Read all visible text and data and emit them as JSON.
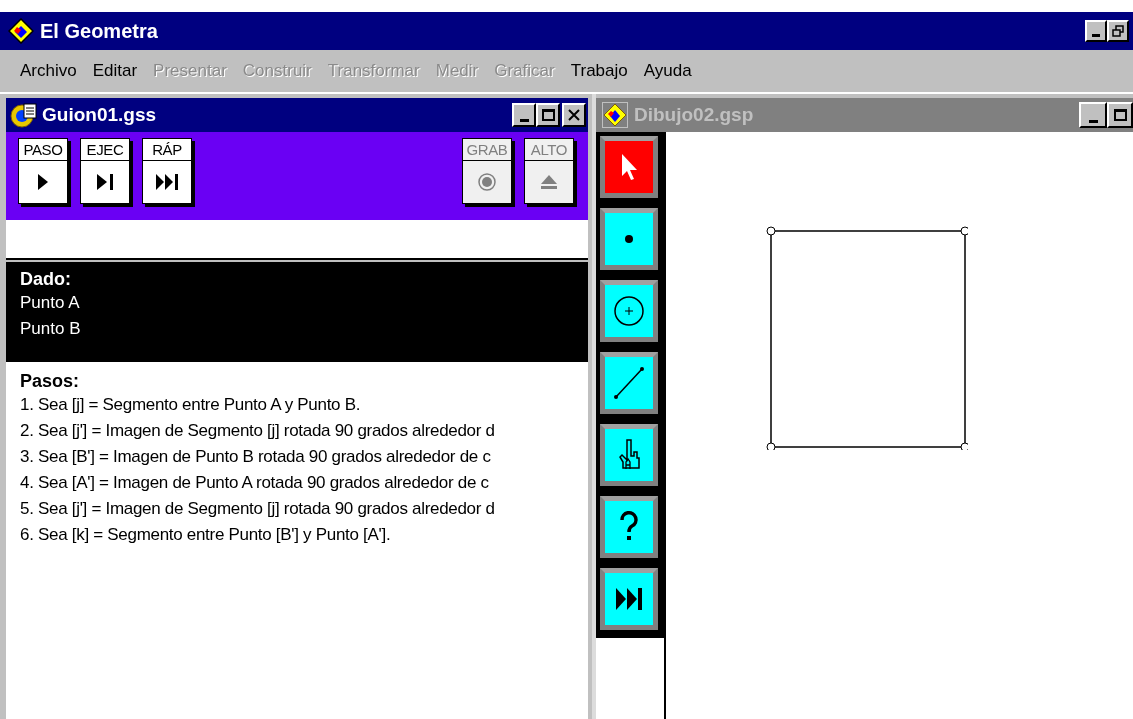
{
  "app": {
    "title": "El Geometra"
  },
  "menu": [
    {
      "label": "Archivo",
      "disabled": false
    },
    {
      "label": "Editar",
      "disabled": false
    },
    {
      "label": "Presentar",
      "disabled": true
    },
    {
      "label": "Construir",
      "disabled": true
    },
    {
      "label": "Transformar",
      "disabled": true
    },
    {
      "label": "Medir",
      "disabled": true
    },
    {
      "label": "Graficar",
      "disabled": true
    },
    {
      "label": "Trabajo",
      "disabled": false
    },
    {
      "label": "Ayuda",
      "disabled": false
    }
  ],
  "script_window": {
    "title": "Guion01.gss",
    "active": true,
    "controls": [
      {
        "label": "PASO",
        "kind": "step",
        "disabled": false
      },
      {
        "label": "EJEC",
        "kind": "run",
        "disabled": false
      },
      {
        "label": "RÁP",
        "kind": "fast",
        "disabled": false
      },
      {
        "label": "GRAB",
        "kind": "record",
        "disabled": true
      },
      {
        "label": "ALTO",
        "kind": "stop",
        "disabled": true
      }
    ],
    "given": {
      "heading": "Dado:",
      "items": [
        "Punto A",
        "Punto B"
      ]
    },
    "steps": {
      "heading": "Pasos:",
      "items": [
        "1. Sea [j] = Segmento entre Punto A y Punto B.",
        "2. Sea [j'] = Imagen de Segmento [j] rotada 90 grados alrededor d",
        "3. Sea [B'] = Imagen de Punto B rotada 90 grados alrededor de c",
        "4. Sea [A'] = Imagen de Punto A rotada 90 grados alrededor de c",
        "5. Sea [j'] = Imagen de Segmento [j] rotada 90 grados alrededor d",
        "6. Sea [k] = Segmento entre Punto [B'] y Punto [A']."
      ]
    }
  },
  "sketch_window": {
    "title": "Dibujo02.gsp",
    "active": false,
    "tools": [
      {
        "kind": "pointer",
        "selected": true
      },
      {
        "kind": "point",
        "selected": false
      },
      {
        "kind": "circle",
        "selected": false
      },
      {
        "kind": "segment",
        "selected": false
      },
      {
        "kind": "text",
        "selected": false
      },
      {
        "kind": "info",
        "selected": false
      },
      {
        "kind": "script",
        "selected": false
      }
    ]
  }
}
